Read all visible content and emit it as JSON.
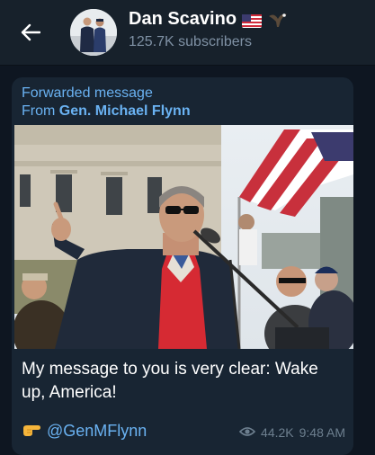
{
  "header": {
    "title": "Dan Scavino",
    "title_emoji_icons": [
      "us-flag-icon",
      "eagle-icon"
    ],
    "subtitle": "125.7K subscribers",
    "colors": {
      "bar": "#17212b",
      "subtitle": "#7f91a4"
    }
  },
  "message": {
    "forward_label": "Forwarded message",
    "forward_from_prefix": "From",
    "forward_from_name": "Gen. Michael Flynn",
    "text": "My message to you is very clear: Wake up, America!",
    "mention_icon": "pointing-hand-icon",
    "mention": "@GenMFlynn",
    "views": "44.2K",
    "time": "9:48 AM",
    "colors": {
      "bubble": "#182533",
      "link": "#6ab2f2",
      "meta": "#6d7f8f"
    }
  },
  "theme": {
    "background": "#0e1621"
  }
}
